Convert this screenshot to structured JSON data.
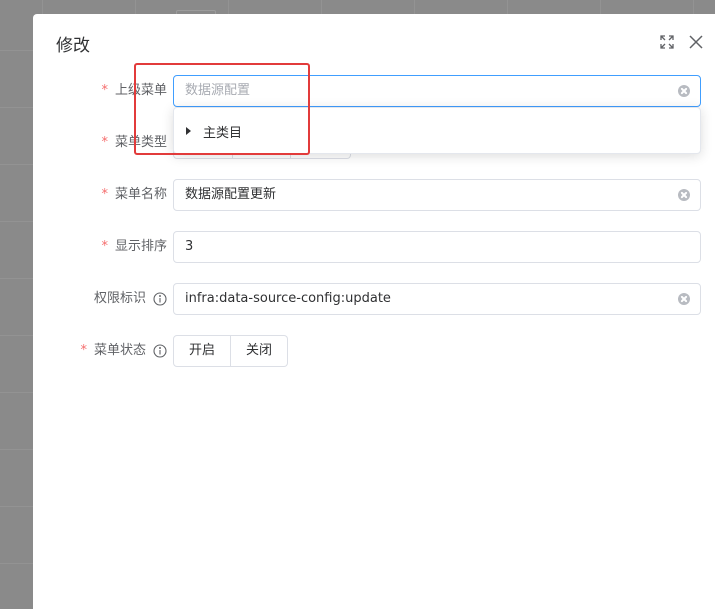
{
  "dialog": {
    "title": "修改",
    "fullscreen_icon": "fullscreen-icon",
    "close_icon": "close-icon"
  },
  "form": {
    "parent_menu": {
      "label": "上级菜单",
      "required": true,
      "placeholder": "数据源配置",
      "value": ""
    },
    "parent_menu_dropdown": {
      "items": [
        {
          "label": "主类目",
          "icon": "caret-right-icon"
        }
      ]
    },
    "menu_type": {
      "label": "菜单类型",
      "required": true
    },
    "menu_name": {
      "label": "菜单名称",
      "required": true,
      "value": "数据源配置更新"
    },
    "sort": {
      "label": "显示排序",
      "required": true,
      "value": "3"
    },
    "permission": {
      "label": "权限标识",
      "required": false,
      "value": "infra:data-source-config:update",
      "icon": "info-icon"
    },
    "status": {
      "label": "菜单状态",
      "required": true,
      "icon": "info-icon",
      "options": [
        "开启",
        "关闭"
      ]
    }
  },
  "colors": {
    "required": "#f56c6c",
    "focus": "#409eff",
    "highlight": "#e23b3b"
  }
}
